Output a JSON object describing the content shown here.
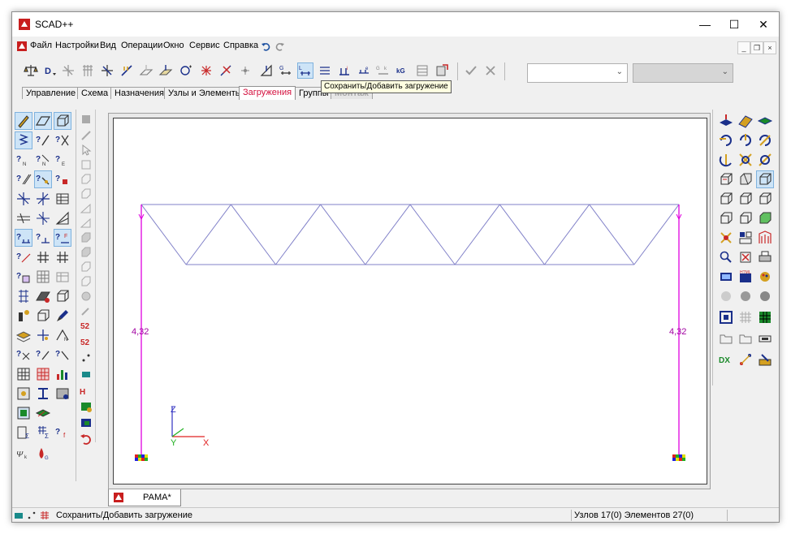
{
  "window": {
    "title": "SCAD++"
  },
  "menu": [
    "Файл",
    "Настройки",
    "Вид",
    "Операции",
    "Окно",
    "Сервис",
    "Справка"
  ],
  "tabs": [
    {
      "label": "Управление",
      "state": "normal"
    },
    {
      "label": "Схема",
      "state": "normal"
    },
    {
      "label": "Назначения",
      "state": "normal"
    },
    {
      "label": "Узлы и Элементы",
      "state": "normal"
    },
    {
      "label": "Загружения",
      "state": "active"
    },
    {
      "label": "Группы",
      "state": "normal"
    },
    {
      "label": "Монтаж",
      "state": "disabled"
    }
  ],
  "toolbar": {
    "tooltip": "Сохранить/Добавить загружение",
    "combo1_value": "",
    "combo2_value": ""
  },
  "canvas": {
    "left_label": "4,32",
    "right_label": "4,32",
    "axis_z": "Z",
    "axis_y": "Y",
    "axis_x": "X"
  },
  "document_tab": {
    "label": "РАМА*"
  },
  "status": {
    "message": "Сохранить/Добавить загружение",
    "counts": "Узлов 17(0) Элементов 27(0)"
  },
  "colors": {
    "accent_tab": "#d4103e",
    "truss": "#8080c8",
    "column": "#e000e0",
    "label": "#a000a0",
    "axis_z": "#3030c0",
    "axis_y": "#20b020",
    "axis_x": "#e02020"
  }
}
